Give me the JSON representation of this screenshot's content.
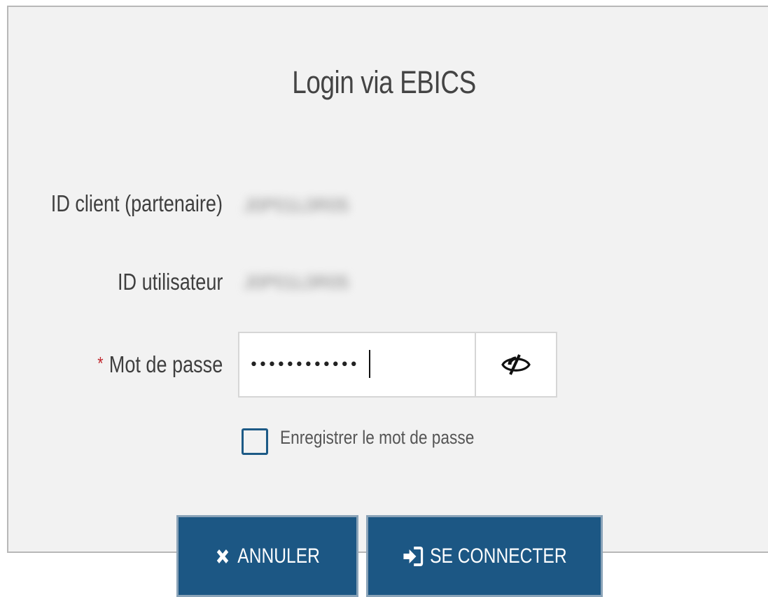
{
  "dialog": {
    "title": "Login via EBICS"
  },
  "form": {
    "partner_id": {
      "label": "ID client (partenaire)",
      "value": "J0P01L0R05"
    },
    "user_id": {
      "label": "ID utilisateur",
      "value": "J0P01L0R05"
    },
    "password": {
      "required_marker": "*",
      "label": "Mot de passe",
      "value": "••••••••••••",
      "toggle_icon": "eye-slash-icon"
    },
    "remember": {
      "label": "Enregistrer le mot de passe",
      "checked": false
    }
  },
  "buttons": {
    "cancel": {
      "icon": "close-icon",
      "label": "ANNULER"
    },
    "connect": {
      "icon": "sign-in-icon",
      "label": "SE CONNECTER"
    }
  },
  "colors": {
    "primary": "#1c5784",
    "required": "#c0272d",
    "dialog_bg": "#f2f2f2"
  }
}
